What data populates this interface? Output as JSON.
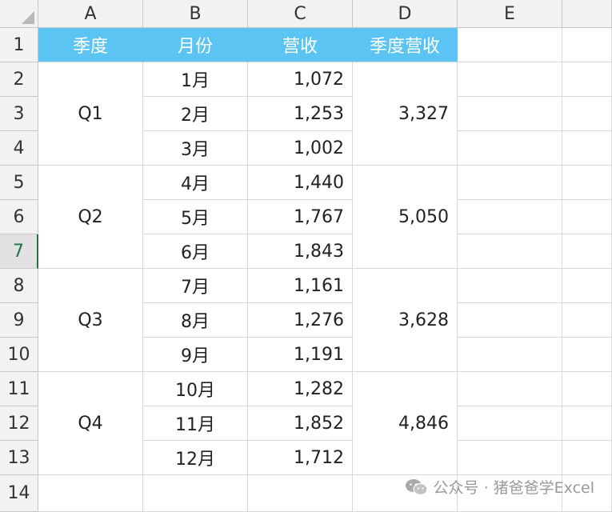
{
  "column_headers": [
    "A",
    "B",
    "C",
    "D",
    "E"
  ],
  "row_numbers": [
    "1",
    "2",
    "3",
    "4",
    "5",
    "6",
    "7",
    "8",
    "9",
    "10",
    "11",
    "12",
    "13",
    "14"
  ],
  "active_row": "7",
  "header_labels": [
    "季度",
    "月份",
    "营收",
    "季度营收"
  ],
  "header_color": "#5bc4f2",
  "quarters": [
    {
      "label": "Q1",
      "total": "3,327",
      "months": [
        {
          "month": "1月",
          "revenue": "1,072"
        },
        {
          "month": "2月",
          "revenue": "1,253"
        },
        {
          "month": "3月",
          "revenue": "1,002"
        }
      ]
    },
    {
      "label": "Q2",
      "total": "5,050",
      "months": [
        {
          "month": "4月",
          "revenue": "1,440"
        },
        {
          "month": "5月",
          "revenue": "1,767"
        },
        {
          "month": "6月",
          "revenue": "1,843"
        }
      ]
    },
    {
      "label": "Q3",
      "total": "3,628",
      "months": [
        {
          "month": "7月",
          "revenue": "1,161"
        },
        {
          "month": "8月",
          "revenue": "1,276"
        },
        {
          "month": "9月",
          "revenue": "1,191"
        }
      ]
    },
    {
      "label": "Q4",
      "total": "4,846",
      "months": [
        {
          "month": "10月",
          "revenue": "1,282"
        },
        {
          "month": "11月",
          "revenue": "1,852"
        },
        {
          "month": "12月",
          "revenue": "1,712"
        }
      ]
    }
  ],
  "watermark": {
    "text": "公众号 · 猪爸爸学Excel",
    "icon": "wechat-icon"
  }
}
